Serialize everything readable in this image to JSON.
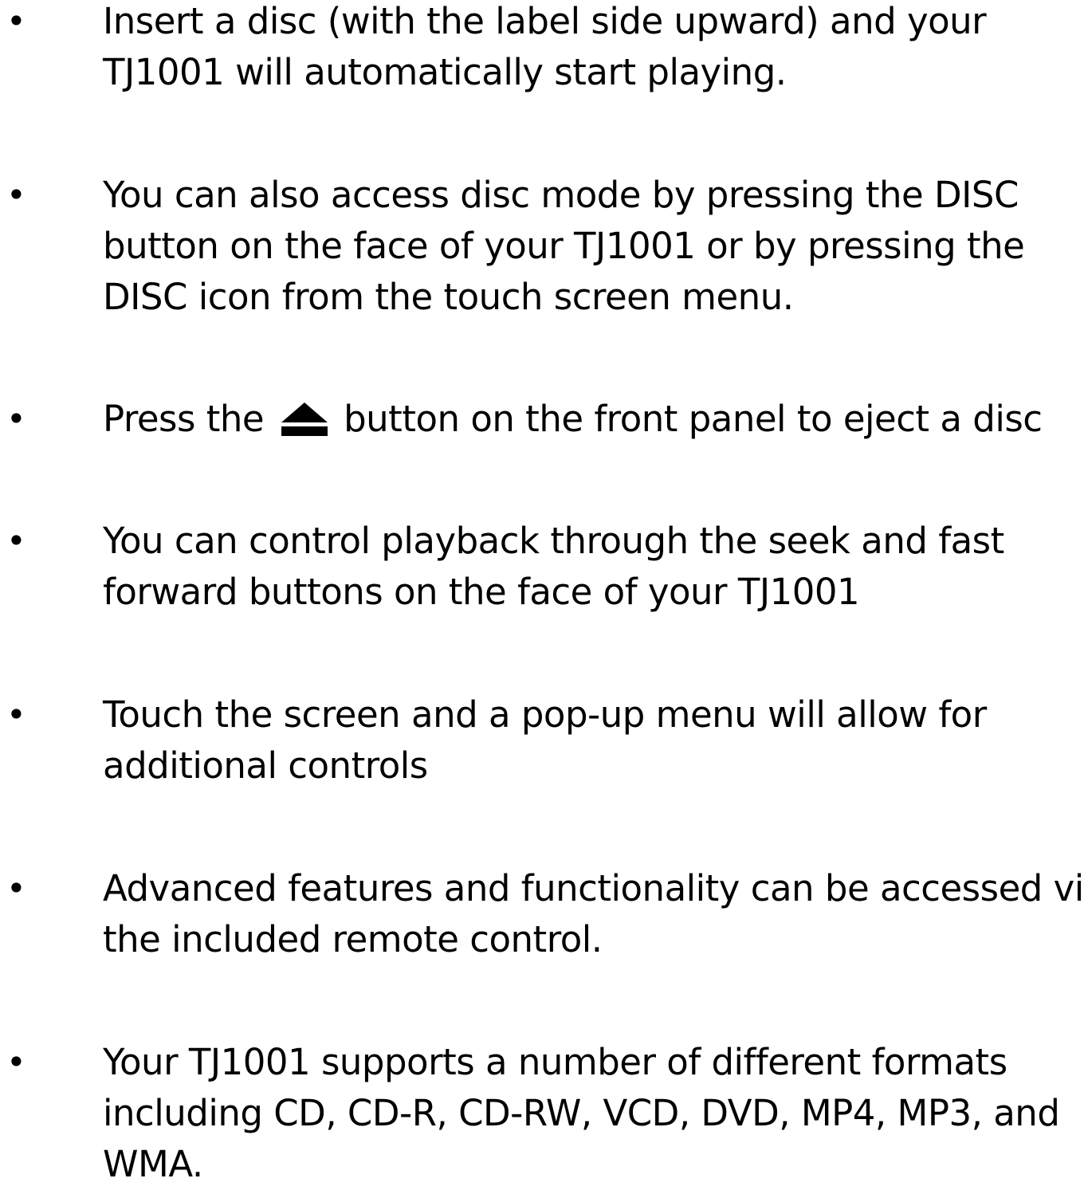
{
  "bullets": [
    {
      "lines": [
        "Insert a disc (with the label side upward) and your",
        "TJ1001 will automatically start playing."
      ]
    },
    {
      "lines": [
        "You can also access disc mode by pressing the DISC",
        "button on the face of your TJ1001 or by pressing the",
        "DISC icon from the touch screen menu."
      ]
    },
    {
      "before_icon": "Press the",
      "icon": "eject-icon",
      "after_icon": "button on the front panel to eject a disc"
    },
    {
      "lines": [
        "You can control playback through the seek and fast",
        "forward buttons on the face of your TJ1001"
      ]
    },
    {
      "lines": [
        "Touch the screen and a pop-up menu will allow for",
        "additional controls"
      ]
    },
    {
      "lines": [
        "Advanced features and functionality can be accessed via",
        "the included remote control."
      ]
    },
    {
      "lines": [
        "Your TJ1001 supports a number of different formats",
        "including CD, CD-R, CD-RW, VCD, DVD, MP4, MP3, and",
        "WMA."
      ]
    }
  ],
  "bullet_char": "•",
  "text_color": "#000000",
  "background_color": "#ffffff"
}
